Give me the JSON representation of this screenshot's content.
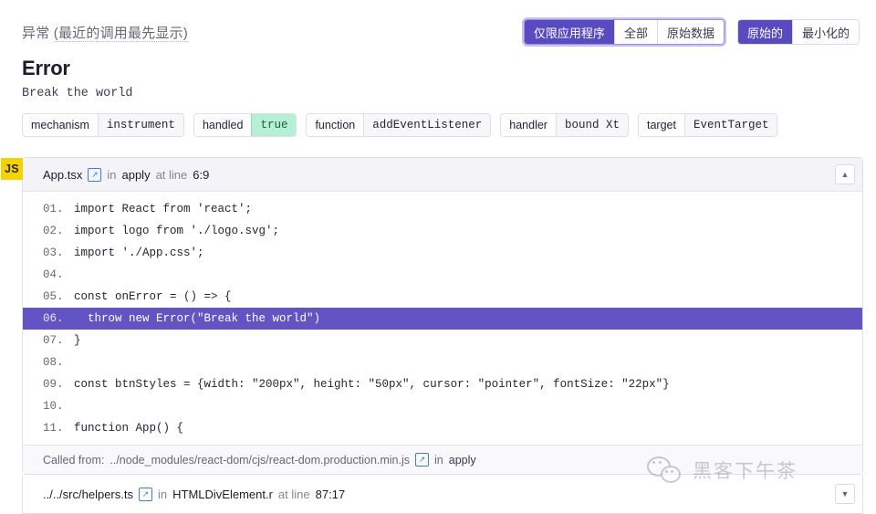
{
  "header": {
    "exception_label": "异常",
    "exception_hint": "(最近的调用最先显示)",
    "scope_group": [
      {
        "label": "仅限应用程序",
        "active": true
      },
      {
        "label": "全部",
        "active": false
      },
      {
        "label": "原始数据",
        "active": false
      }
    ],
    "format_group": [
      {
        "label": "原始的",
        "active": true
      },
      {
        "label": "最小化的",
        "active": false
      }
    ]
  },
  "error": {
    "type": "Error",
    "value": "Break the world"
  },
  "pills": [
    {
      "key": "mechanism",
      "value": "instrument",
      "highlight": false
    },
    {
      "key": "handled",
      "value": "true",
      "highlight": true
    },
    {
      "key": "function",
      "value": "addEventListener",
      "highlight": false
    },
    {
      "key": "handler",
      "value": "bound Xt",
      "highlight": false
    },
    {
      "key": "target",
      "value": "EventTarget",
      "highlight": false
    }
  ],
  "frame": {
    "badge": "JS",
    "file": "App.tsx",
    "link_icon": "external-link-icon",
    "in_word": "in",
    "function": "apply",
    "at_line_word": "at line",
    "line": "6:9",
    "collapse_icon": "chevron-up-icon",
    "called_from_label": "Called from:",
    "called_from_path": "../node_modules/react-dom/cjs/react-dom.production.min.js",
    "called_from_in": "in",
    "called_from_fn": "apply",
    "code": [
      {
        "num": "01.",
        "src": "import React from 'react';",
        "highlight": false
      },
      {
        "num": "02.",
        "src": "import logo from './logo.svg';",
        "highlight": false
      },
      {
        "num": "03.",
        "src": "import './App.css';",
        "highlight": false
      },
      {
        "num": "04.",
        "src": "",
        "highlight": false
      },
      {
        "num": "05.",
        "src": "const onError = () => {",
        "highlight": false
      },
      {
        "num": "06.",
        "src": "  throw new Error(\"Break the world\")",
        "highlight": true
      },
      {
        "num": "07.",
        "src": "}",
        "highlight": false
      },
      {
        "num": "08.",
        "src": "",
        "highlight": false
      },
      {
        "num": "09.",
        "src": "const btnStyles = {width: \"200px\", height: \"50px\", cursor: \"pointer\", fontSize: \"22px\"}",
        "highlight": false
      },
      {
        "num": "10.",
        "src": "",
        "highlight": false
      },
      {
        "num": "11.",
        "src": "function App() {",
        "highlight": false
      }
    ]
  },
  "frame2": {
    "file": "../../src/helpers.ts",
    "link_icon": "external-link-icon",
    "in_word": "in",
    "function": "HTMLDivElement.r",
    "at_line_word": "at line",
    "line": "87:17",
    "expand_icon": "chevron-down-icon"
  },
  "watermark": {
    "text": "黑客下午茶"
  },
  "colors": {
    "accent": "#584ac0",
    "highlight_line": "#6354c4",
    "badge": "#f5d202",
    "ok": "#b6f0d4",
    "link": "#3b7ddd"
  }
}
